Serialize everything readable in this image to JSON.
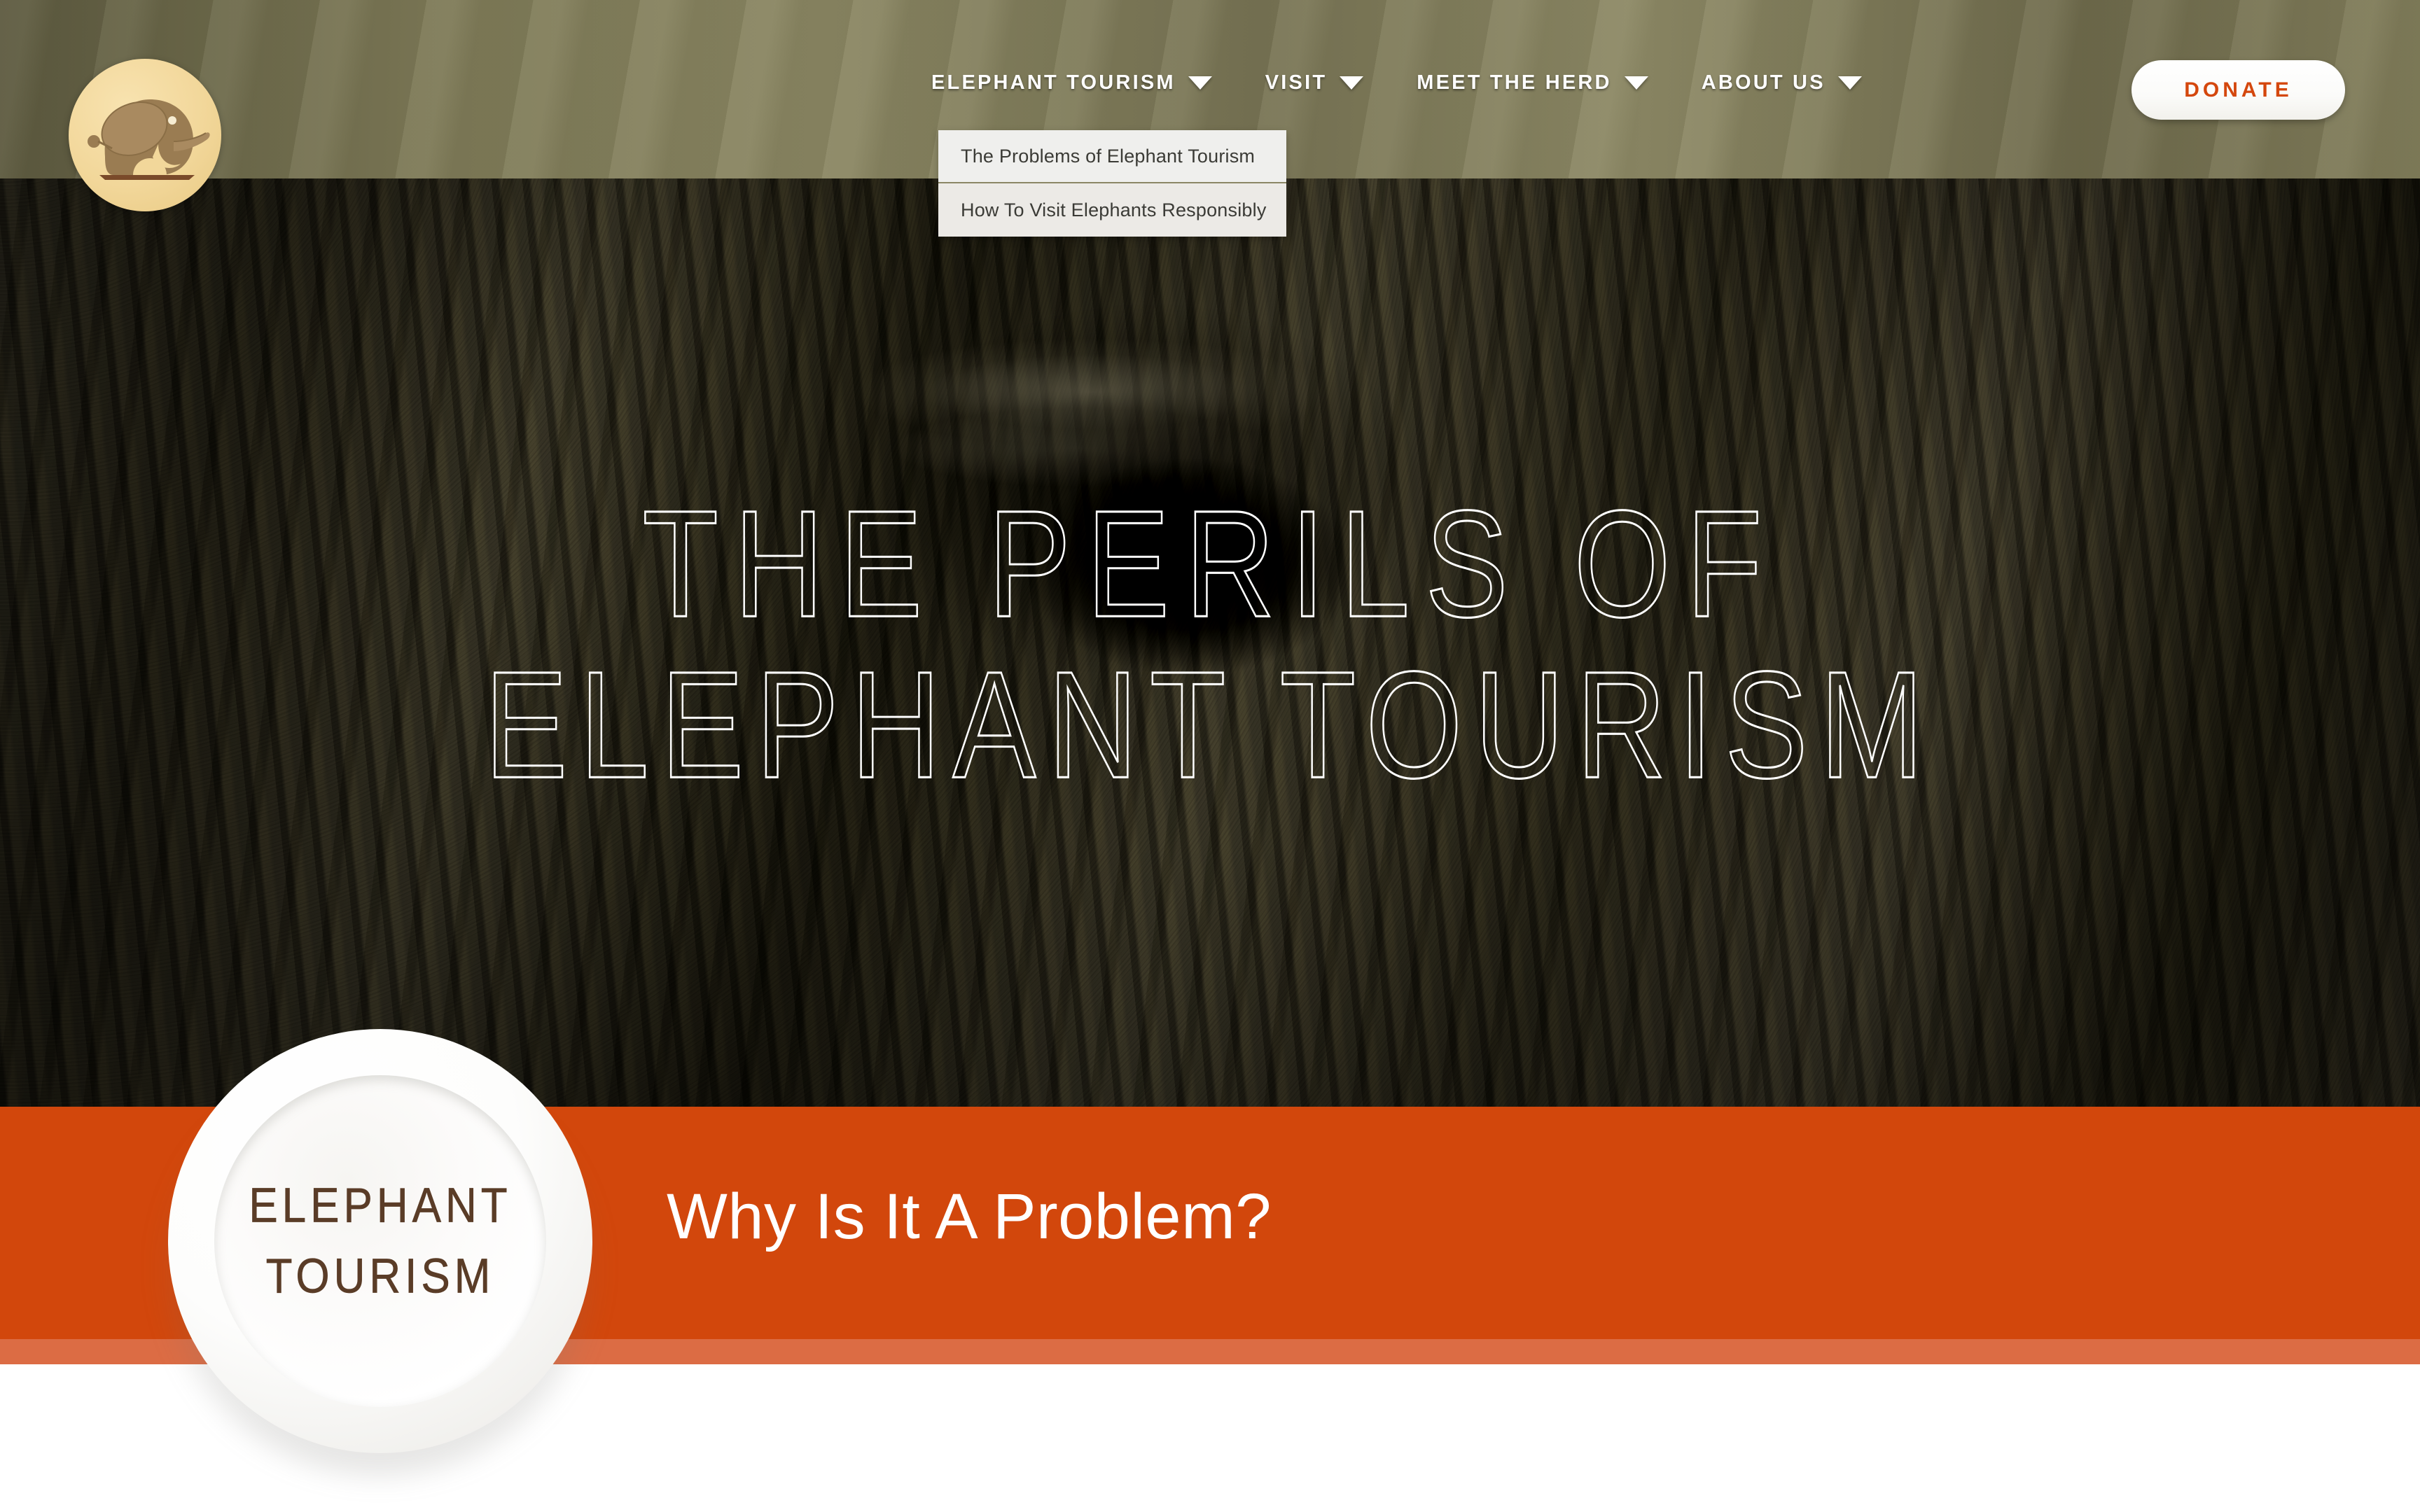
{
  "site": {
    "logo_icon": "elephant-logo-icon",
    "logo_alt": "Elephant Tourism"
  },
  "nav": {
    "items": [
      {
        "label": "ELEPHANT TOURISM",
        "caret_icon": "chevron-down-icon",
        "has_caret": true
      },
      {
        "label": "VISIT",
        "caret_icon": "chevron-down-icon",
        "has_caret": true
      },
      {
        "label": "MEET THE HERD",
        "caret_icon": "chevron-down-icon",
        "has_caret": true
      },
      {
        "label": "ABOUT US",
        "caret_icon": "chevron-down-icon",
        "has_caret": true
      }
    ],
    "donate_label": "DONATE",
    "dropdown": {
      "open_for": "ELEPHANT TOURISM",
      "items": [
        {
          "label": "The Problems of Elephant Tourism"
        },
        {
          "label": "How To Visit Elephants Responsibly"
        }
      ]
    }
  },
  "hero": {
    "title_line1": "THE PERILS OF",
    "title_line2": "ELEPHANT TOURISM",
    "image_alt": "Close-up of an elephant eye and wrinkled skin"
  },
  "section": {
    "heading": "Why Is It A Problem?"
  },
  "badge": {
    "line1": "ELEPHANT",
    "line2": "TOURISM"
  },
  "colors": {
    "brand_orange": "#d2470c",
    "band_strip_orange": "#dc6c44",
    "header_olive": "#7e7a57",
    "logo_cream": "#f2d79a",
    "logo_brown": "#9a7c52",
    "badge_text_brown": "#5a3c27",
    "donate_text": "#d4470d",
    "nav_text": "#ffffff",
    "dropdown_bg": "#efefed",
    "dropdown_text": "#3b3b36"
  }
}
